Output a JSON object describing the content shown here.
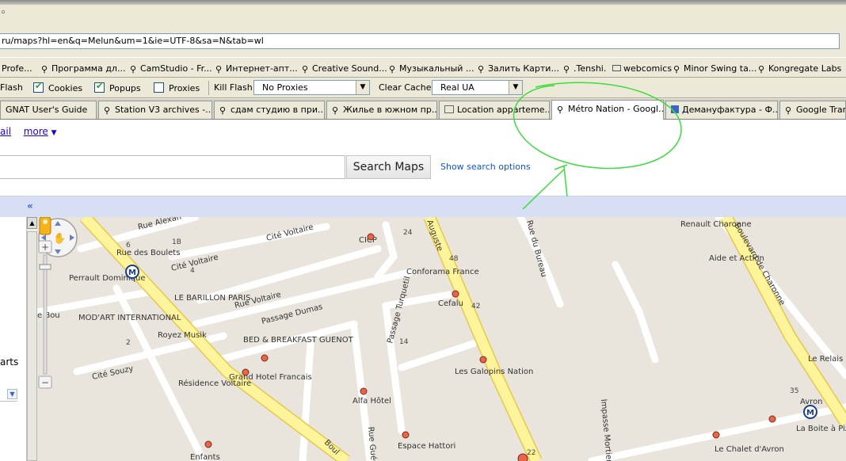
{
  "browser": {
    "url": "ru/maps?hl=en&q=Melun&um=1&ie=UTF-8&sa=N&tab=wl",
    "bookmarks": [
      "Profe...",
      "Программа дл...",
      "CamStudio - Fr...",
      "Интернет-апт...",
      "Creative Sound...",
      "Музыкальный ...",
      "Залить Карти...",
      ".Tenshi.",
      "webcomics",
      "Minor Swing ta...",
      "Kongregate Labs"
    ],
    "toolbar": {
      "flash": "Flash",
      "cookies": "Cookies",
      "popups": "Popups",
      "proxies": "Proxies",
      "kill_flash": "Kill Flash",
      "proxy_select": "No Proxies",
      "clear_cache": "Clear Cache",
      "ua_select": "Real UA"
    },
    "tabs": [
      "GNAT User's Guide",
      "Station V3 archives -...",
      "сдам студию в при...",
      "Жилье в южном пр...",
      "Location apparteme...",
      "Métro Nation - Googl...",
      "Демануфактура - Ф...",
      "Google Trans"
    ]
  },
  "page": {
    "links": {
      "mail": "ail",
      "more": "more",
      "more_arrow": "▼"
    },
    "search_button": "Search Maps",
    "show_search_options": "Show search options",
    "collapse": "«",
    "sidebar_text": "arts",
    "sidebar_dd": "▼"
  },
  "map": {
    "streets": [
      "Rue Alexan",
      "Cité Voltaire",
      "Cité Voltaire",
      "Rue Voltaire",
      "Passage Dumas",
      "Cité Souzy",
      "Passage Turquetil",
      "Rue Guérin",
      "Boulevard de Charonne",
      "Rue du Bureau",
      "Impasse Mortier",
      "Auguste",
      "e Bou",
      "Boul"
    ],
    "pois": [
      "Rue des Boulets",
      "Perrault Dominique",
      "LE BARILLON PARIS",
      "MOD'ART INTERNATIONAL",
      "Royez Musik",
      "BED & BREAKFAST GUENOT",
      "Grand Hotel Francais",
      "Résidence Voltaire",
      "Enfants",
      "CICP",
      "Conforama France",
      "Cefalu",
      "Les Galopins Nation",
      "Alfa Hôtel",
      "Espace Hattori",
      "Renault Charonne",
      "Aide et Action",
      "Le Relais d'Avron",
      "Avron",
      "La Boite à Pizza",
      "Le Chalet d'Avron"
    ],
    "numbers": [
      "6",
      "1B",
      "4",
      "2",
      "24",
      "48",
      "42",
      "14",
      "35",
      "22"
    ],
    "metro_symbol": "M"
  }
}
